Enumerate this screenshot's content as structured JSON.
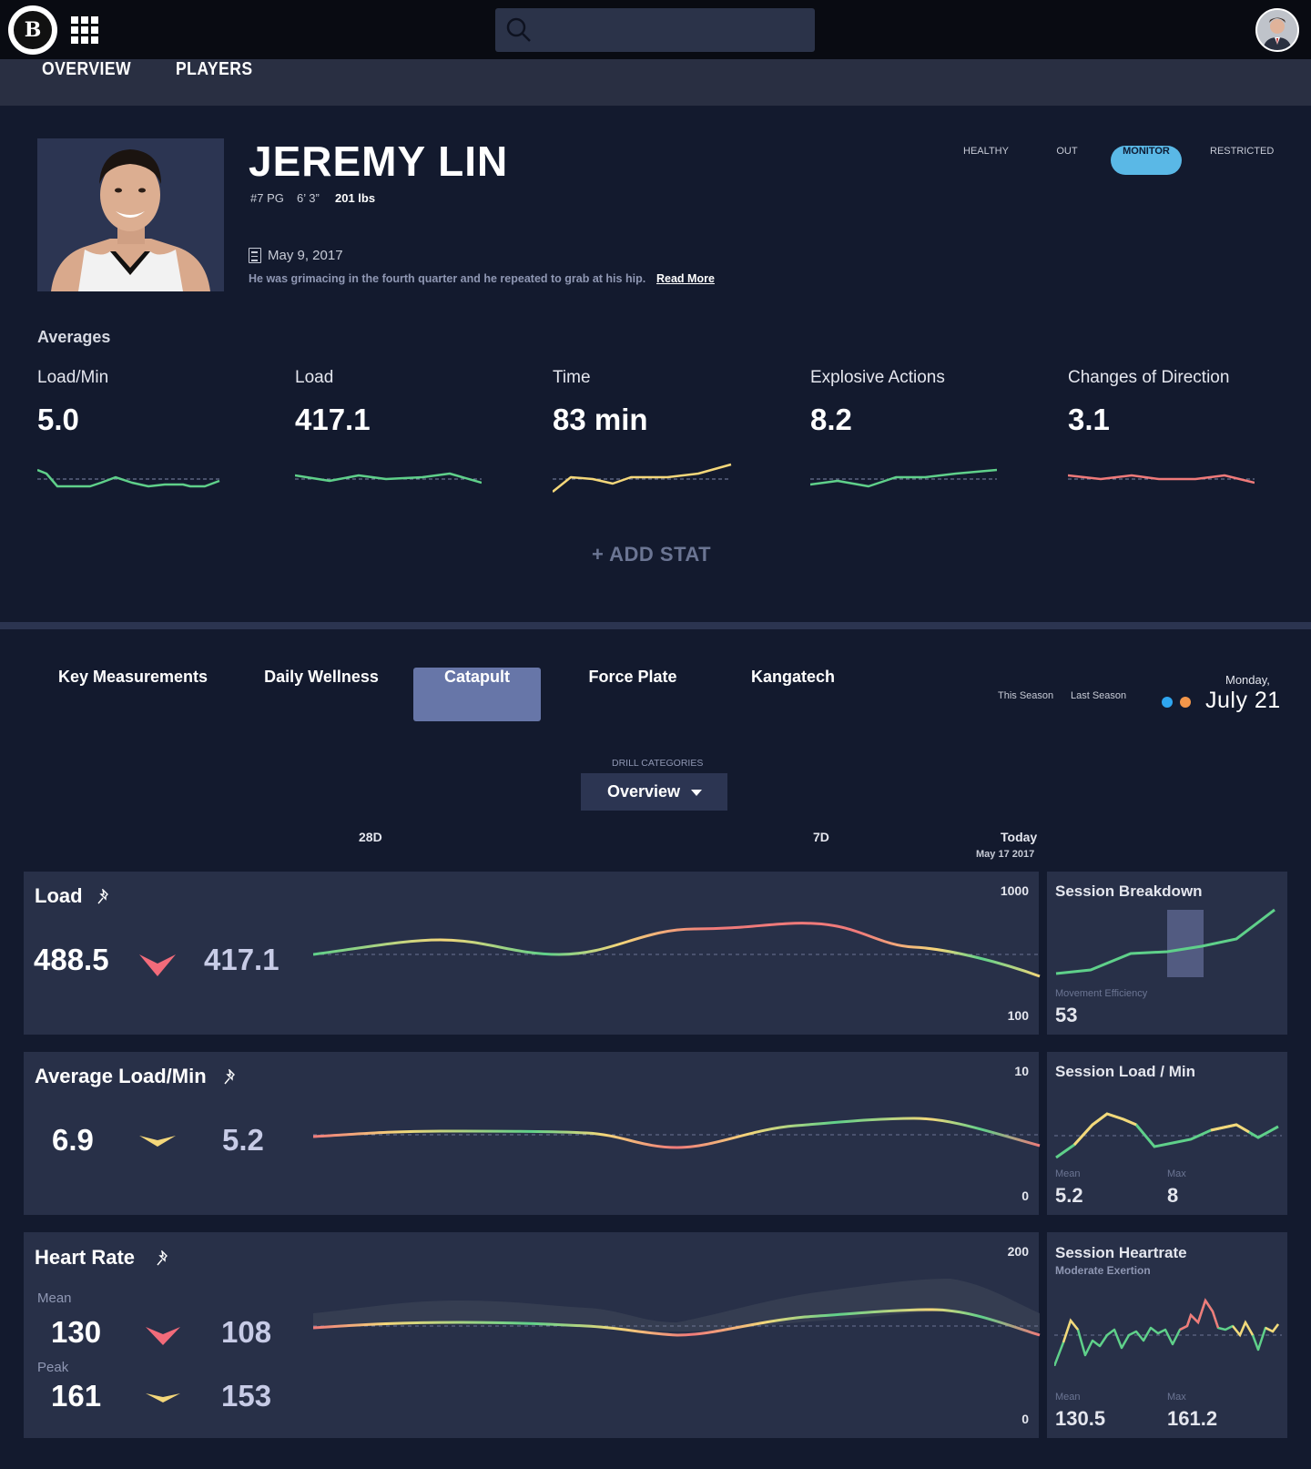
{
  "topbar": {
    "logo_letter": "B",
    "logo_name": "brooklyn-nets-logo",
    "search_placeholder": ""
  },
  "nav": {
    "items": [
      "OVERVIEW",
      "PLAYERS"
    ]
  },
  "player": {
    "name": "JEREMY LIN",
    "number_position": "#7 PG",
    "height": "6’ 3”",
    "weight": "201 lbs",
    "note_date": "May 9, 2017",
    "note_text": "He was grimacing in the fourth quarter and he repeated to grab at his hip.",
    "read_more": "Read More"
  },
  "status_options": [
    "HEALTHY",
    "OUT",
    "MONITOR",
    "RESTRICTED"
  ],
  "status_selected": "MONITOR",
  "averages": {
    "title": "Averages",
    "items": [
      {
        "label": "Load/Min",
        "value": "5.0",
        "color": "#5fd08a"
      },
      {
        "label": "Load",
        "value": "417.1",
        "color": "#5fd08a"
      },
      {
        "label": "Time",
        "value": "83 min",
        "color": "#f4d77a"
      },
      {
        "label": "Explosive Actions",
        "value": "8.2",
        "color": "#5fd08a"
      },
      {
        "label": "Changes of Direction",
        "value": "3.1",
        "color": "#f07a7a"
      }
    ],
    "add_stat": "+ ADD STAT"
  },
  "tabs": [
    "Key Measurements",
    "Daily Wellness",
    "Catapult",
    "Force Plate",
    "Kangatech"
  ],
  "tab_selected": "Catapult",
  "season": {
    "this": "This Season",
    "last": "Last Season",
    "this_color": "#2fa6f0",
    "last_color": "#f3964a"
  },
  "date": {
    "day": "Monday,",
    "date": "July 21"
  },
  "drill": {
    "label": "DRILL CATEGORIES",
    "value": "Overview"
  },
  "timeline": {
    "left": "28D",
    "mid": "7D",
    "right": "Today",
    "right_sub": "May 17 2017"
  },
  "cards": {
    "load": {
      "title": "Load",
      "prev": "488.5",
      "curr": "417.1",
      "trend": "down",
      "trend_color": "#f26b7a",
      "ymax": "1000",
      "ymin": "100",
      "side": {
        "title": "Session Breakdown",
        "stat_label": "Movement Efficiency",
        "stat_value": "53"
      }
    },
    "avg_load_min": {
      "title": "Average Load/Min",
      "prev": "6.9",
      "curr": "5.2",
      "trend": "flat",
      "trend_color": "#f4d77a",
      "ymax": "10",
      "ymin": "0",
      "side": {
        "title": "Session Load / Min",
        "mean_label": "Mean",
        "mean_value": "5.2",
        "max_label": "Max",
        "max_value": "8"
      }
    },
    "heart_rate": {
      "title": "Heart Rate",
      "mean_label": "Mean",
      "mean_prev": "130",
      "mean_curr": "108",
      "mean_trend_color": "#f26b7a",
      "peak_label": "Peak",
      "peak_prev": "161",
      "peak_curr": "153",
      "peak_trend_color": "#f4d77a",
      "ymax": "200",
      "ymin": "0",
      "side": {
        "title": "Session Heartrate",
        "subtitle": "Moderate Exertion",
        "mean_label": "Mean",
        "mean_value": "130.5",
        "max_label": "Max",
        "max_value": "161.2"
      }
    }
  }
}
